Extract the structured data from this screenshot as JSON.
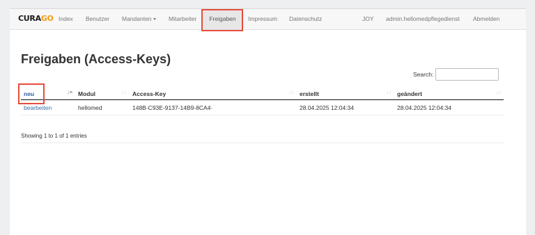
{
  "brand": {
    "prefix": "CURA",
    "suffix": "GO"
  },
  "nav": {
    "left": [
      "Index",
      "Benutzer",
      "Mandanten",
      "Mitarbeiter",
      "Freigaben",
      "Impressum",
      "Datenschutz"
    ],
    "right": [
      "JOY",
      "admin.hellomedpflegedienst",
      "Abmelden"
    ],
    "active": "Freigaben"
  },
  "page": {
    "title": "Freigaben (Access-Keys)"
  },
  "search": {
    "label": "Search:",
    "value": ""
  },
  "table": {
    "headers": [
      "neu",
      "Modul",
      "Access-Key",
      "erstellt",
      "geändert"
    ],
    "rows": [
      {
        "action": "bearbeiten",
        "modul": "hellomed",
        "key": "148B-C93E-9137-14B9-8CA4·",
        "erstellt": "28.04.2025 12:04:34",
        "geaendert": "28.04.2025 12:04:34"
      }
    ]
  },
  "info": "Showing 1 to 1 of 1 entries",
  "colors": {
    "highlight": "#e74c3c",
    "link": "#3a6ea5",
    "brand_accent": "#f39c12"
  }
}
